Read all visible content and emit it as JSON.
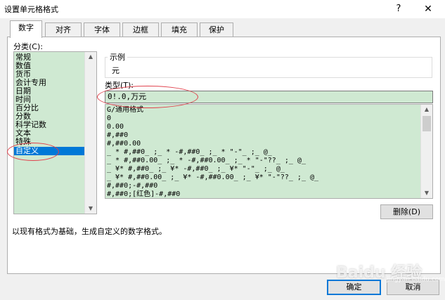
{
  "window": {
    "title": "设置单元格格式",
    "help": "?",
    "close": "✕"
  },
  "tabs": [
    {
      "label": "数字",
      "active": true
    },
    {
      "label": "对齐"
    },
    {
      "label": "字体"
    },
    {
      "label": "边框"
    },
    {
      "label": "填充"
    },
    {
      "label": "保护"
    }
  ],
  "category": {
    "label": "分类(C):",
    "items": [
      "常规",
      "数值",
      "货币",
      "会计专用",
      "日期",
      "时间",
      "百分比",
      "分数",
      "科学记数",
      "文本",
      "特殊",
      "自定义"
    ],
    "selected": "自定义"
  },
  "sample": {
    "label": "示例",
    "value": "元"
  },
  "type": {
    "label": "类型(T):",
    "value": "0!.0,万元",
    "formats": [
      "G/通用格式",
      "0",
      "0.00",
      "#,##0",
      "#,##0.00",
      "_ * #,##0_ ;_ * -#,##0_ ;_ * \"-\"_ ;_ @_",
      "_ * #,##0.00_ ;_ * -#,##0.00_ ;_ * \"-\"??_ ;_ @_",
      "_ ¥* #,##0_ ;_ ¥* -#,##0_ ;_ ¥* \"-\"_ ;_ @_",
      "_ ¥* #,##0.00_ ;_ ¥* -#,##0.00_ ;_ ¥* \"-\"??_ ;_ @_",
      "#,##0;-#,##0",
      "#,##0;[红色]-#,##0"
    ]
  },
  "buttons": {
    "delete": "删除(D)",
    "ok": "确定",
    "cancel": "取消"
  },
  "description": "以现有格式为基础，生成自定义的数字格式。",
  "watermark": {
    "text": "Baidu 经验",
    "url": "jingyan.baidu.com"
  }
}
